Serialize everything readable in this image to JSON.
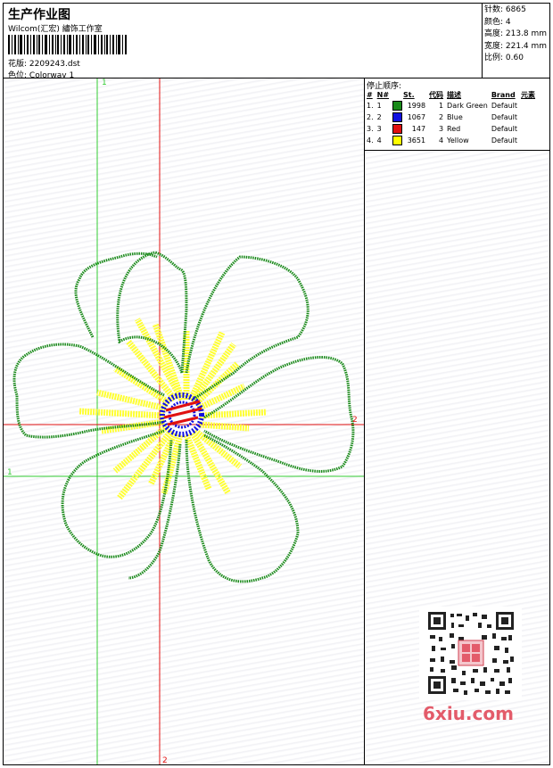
{
  "header": {
    "title": "生产作业图",
    "company": "Wilcom(汇宏) 繡饰工作室",
    "design_label": "花版:",
    "design_value": "2209243.dst",
    "colorway_label": "色位:",
    "colorway_value": "Colorway 1"
  },
  "stats": {
    "stitches": "针数: 6865",
    "colors": "颜色: 4",
    "height": "高度: 213.8 mm",
    "width": "宽度: 221.4 mm",
    "scale": "比例: 0.60"
  },
  "stop_sequence": {
    "title": "停止顺序:",
    "headers": [
      "#",
      "N#",
      "St.",
      "代码",
      "描述",
      "Brand",
      "元素"
    ],
    "rows": [
      {
        "idx": "1.",
        "n": "1",
        "color": "#1a8a1a",
        "st": "1998",
        "code": "1",
        "desc": "Dark Green",
        "brand": "Default"
      },
      {
        "idx": "2.",
        "n": "2",
        "color": "#1010e0",
        "st": "1067",
        "code": "2",
        "desc": "Blue",
        "brand": "Default"
      },
      {
        "idx": "3.",
        "n": "3",
        "color": "#e01010",
        "st": "147",
        "code": "3",
        "desc": "Red",
        "brand": "Default"
      },
      {
        "idx": "4.",
        "n": "4",
        "color": "#ffff00",
        "st": "3651",
        "code": "4",
        "desc": "Yellow",
        "brand": "Default"
      }
    ]
  },
  "markers": {
    "green_top": "1",
    "green_left": "1",
    "red_bottom": "2",
    "red_right": "2"
  },
  "watermark": "6xiu.com",
  "colors": {
    "green_guide": "#33cc33",
    "red_guide": "#e01010",
    "outline": "#1a8a1a",
    "rays": "#ffff33",
    "center_blue": "#1010e0",
    "center_red": "#e01010"
  }
}
